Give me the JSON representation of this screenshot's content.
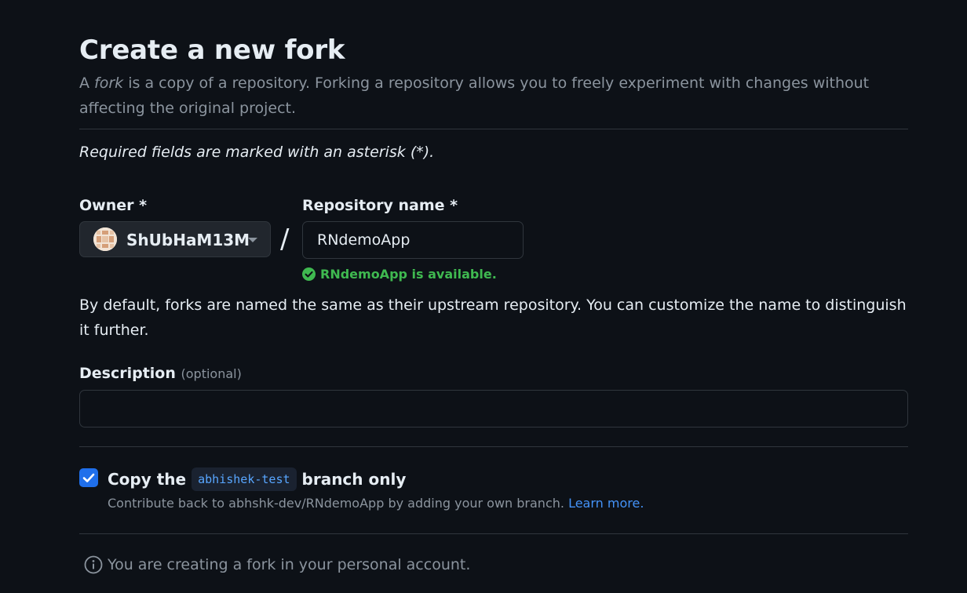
{
  "page": {
    "title": "Create a new fork",
    "intro_prefix": "A ",
    "intro_fork_word": "fork",
    "intro_suffix": " is a copy of a repository. Forking a repository allows you to freely experiment with changes without affecting the original project.",
    "required_note": "Required fields are marked with an asterisk (*)."
  },
  "owner": {
    "label": "Owner *",
    "selected": "ShUbHaM13M",
    "avatar_icon": "identicon-avatar"
  },
  "separator": "/",
  "repository": {
    "label": "Repository name *",
    "value": "RNdemoApp",
    "availability": "RNdemoApp is available.",
    "availability_color": "#3fb950"
  },
  "default_note": "By default, forks are named the same as their upstream repository. You can customize the name to distinguish it further.",
  "description": {
    "label": "Description",
    "optional": "(optional)",
    "value": ""
  },
  "copy_branch": {
    "checked": true,
    "prefix": "Copy the",
    "branch": "abhishek-test",
    "suffix": "branch only",
    "help_text": "Contribute back to abhshk-dev/RNdemoApp by adding your own branch.",
    "learn_more": "Learn more."
  },
  "footer_note": "You are creating a fork in your personal account.",
  "colors": {
    "background": "#0d1117",
    "accent": "#1f6feb",
    "link": "#4493f8",
    "muted": "#8b949e"
  }
}
